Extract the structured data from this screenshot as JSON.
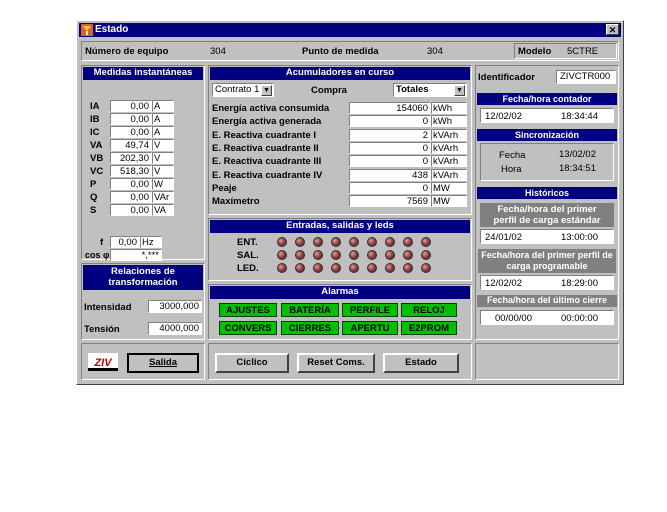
{
  "window": {
    "title": "Estado",
    "close": "✕"
  },
  "top": {
    "equipo_label": "Número de equipo",
    "equipo_value": "304",
    "punto_label": "Punto de medida",
    "punto_value": "304",
    "modelo_label": "Modelo",
    "modelo_value": "5CTRE"
  },
  "instant": {
    "title": "Medidas instantáneas",
    "rows": [
      {
        "name": "IA",
        "value": "0,00",
        "unit": "A"
      },
      {
        "name": "IB",
        "value": "0,00",
        "unit": "A"
      },
      {
        "name": "IC",
        "value": "0,00",
        "unit": "A"
      },
      {
        "name": "VA",
        "value": "49,74",
        "unit": "V"
      },
      {
        "name": "VB",
        "value": "202,30",
        "unit": "V"
      },
      {
        "name": "VC",
        "value": "518,30",
        "unit": "V"
      },
      {
        "name": "P",
        "value": "0,00",
        "unit": "W"
      },
      {
        "name": "Q",
        "value": "0,00",
        "unit": "VAr"
      },
      {
        "name": "S",
        "value": "0,00",
        "unit": "VA"
      }
    ],
    "f_label": "f",
    "f_value": "0,00",
    "f_unit": "Hz",
    "cos_label": "cos φ",
    "cos_value": "*,***"
  },
  "relaciones": {
    "title": "Relaciones de transformación",
    "intensidad_label": "Intensidad",
    "intensidad_value": "3000,000",
    "tension_label": "Tensión",
    "tension_value": "4000,000"
  },
  "acumuladores": {
    "title": "Acumuladores en curso",
    "contrato": "Contrato 1",
    "compra": "Compra",
    "totales": "Totales",
    "rows": [
      {
        "label": "Energía activa consumida",
        "value": "154060",
        "unit": "kWh"
      },
      {
        "label": "Energía activa generada",
        "value": "0",
        "unit": "kWh"
      },
      {
        "label": "E. Reactiva cuadrante I",
        "value": "2",
        "unit": "kVArh"
      },
      {
        "label": "E. Reactiva cuadrante II",
        "value": "0",
        "unit": "kVArh"
      },
      {
        "label": "E. Reactiva cuadrante III",
        "value": "0",
        "unit": "kVArh"
      },
      {
        "label": "E. Reactiva cuadrante IV",
        "value": "438",
        "unit": "kVArh"
      },
      {
        "label": "Peaje",
        "value": "0",
        "unit": "MW"
      },
      {
        "label": "Maxímetro",
        "value": "7569",
        "unit": "MW"
      }
    ]
  },
  "io": {
    "title": "Entradas, salidas y leds",
    "rows": [
      "ENT.",
      "SAL.",
      "LED."
    ],
    "led_color": "#944444"
  },
  "alarmas": {
    "title": "Alarmas",
    "buttons": [
      "AJUSTES",
      "BATERÍA",
      "PERFILE",
      "RELOJ",
      "CONVERS",
      "CIERRES",
      "APERTU",
      "E2PROM"
    ],
    "color": "#00c000"
  },
  "right": {
    "identificador_label": "Identificador",
    "identificador_value": "ZIVCTR000",
    "contador_title": "Fecha/hora contador",
    "contador_fecha": "12/02/02",
    "contador_hora": "18:34:44",
    "sync_title": "Sincronización",
    "sync_fecha_label": "Fecha",
    "sync_fecha": "13/02/02",
    "sync_hora_label": "Hora",
    "sync_hora": "18:34:51",
    "hist_title": "Históricos",
    "estandar_title": "Fecha/hora del primer perfil de carga estándar",
    "estandar_fecha": "24/01/02",
    "estandar_hora": "13:00:00",
    "programable_title": "Fecha/hora del primer perfil de carga programable",
    "programable_fecha": "12/02/02",
    "programable_hora": "18:29:00",
    "cierre_title": "Fecha/hora del último cierre",
    "cierre_fecha": "00/00/00",
    "cierre_hora": "00:00:00"
  },
  "bottom": {
    "logo": "ZIV",
    "salida": "Salida",
    "ciclico": "Cíclico",
    "reset": "Reset Coms.",
    "estado": "Estado"
  },
  "colors": {
    "title_bar": "#000080",
    "panel": "#c0c0c0"
  }
}
